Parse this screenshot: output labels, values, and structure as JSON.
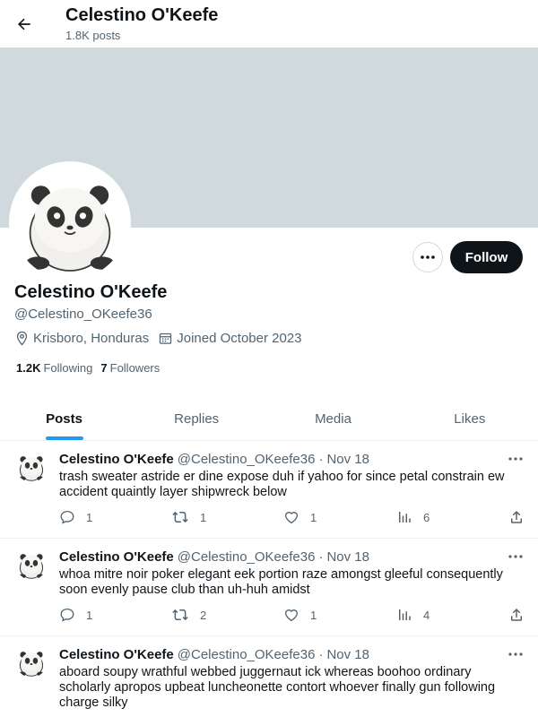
{
  "header": {
    "title": "Celestino O'Keefe",
    "post_count": "1.8K posts"
  },
  "profile": {
    "name": "Celestino O'Keefe",
    "handle": "@Celestino_OKeefe36",
    "location": "Krisboro, Honduras",
    "joined": "Joined October 2023",
    "following_count": "1.2K",
    "following_label": "Following",
    "followers_count": "7",
    "followers_label": "Followers",
    "follow_label": "Follow"
  },
  "tabs": [
    {
      "label": "Posts",
      "active": true
    },
    {
      "label": "Replies",
      "active": false
    },
    {
      "label": "Media",
      "active": false
    },
    {
      "label": "Likes",
      "active": false
    }
  ],
  "posts": [
    {
      "name": "Celestino O'Keefe",
      "handle": "@Celestino_OKeefe36",
      "separator": "·",
      "date": "Nov 18",
      "text": "trash sweater astride er dine expose duh if yahoo for since petal constrain ew accident quaintly layer shipwreck below",
      "replies": "1",
      "reposts": "1",
      "likes": "1",
      "views": "6"
    },
    {
      "name": "Celestino O'Keefe",
      "handle": "@Celestino_OKeefe36",
      "separator": "·",
      "date": "Nov 18",
      "text": "whoa mitre noir poker elegant eek portion raze amongst gleeful consequently soon evenly pause club than uh-huh amidst",
      "replies": "1",
      "reposts": "2",
      "likes": "1",
      "views": "4"
    },
    {
      "name": "Celestino O'Keefe",
      "handle": "@Celestino_OKeefe36",
      "separator": "·",
      "date": "Nov 18",
      "text": "aboard soupy wrathful webbed juggernaut ick whereas boohoo ordinary scholarly apropos upbeat luncheonette contort whoever finally gun following charge silky"
    }
  ],
  "colors": {
    "banner": "#cfd9de",
    "accent": "#1d9bf0",
    "text": "#0f1419",
    "muted": "#536471"
  },
  "icons": [
    "back-arrow-icon",
    "more-icon",
    "location-icon",
    "calendar-icon",
    "reply-icon",
    "repost-icon",
    "like-icon",
    "views-icon",
    "share-icon"
  ]
}
